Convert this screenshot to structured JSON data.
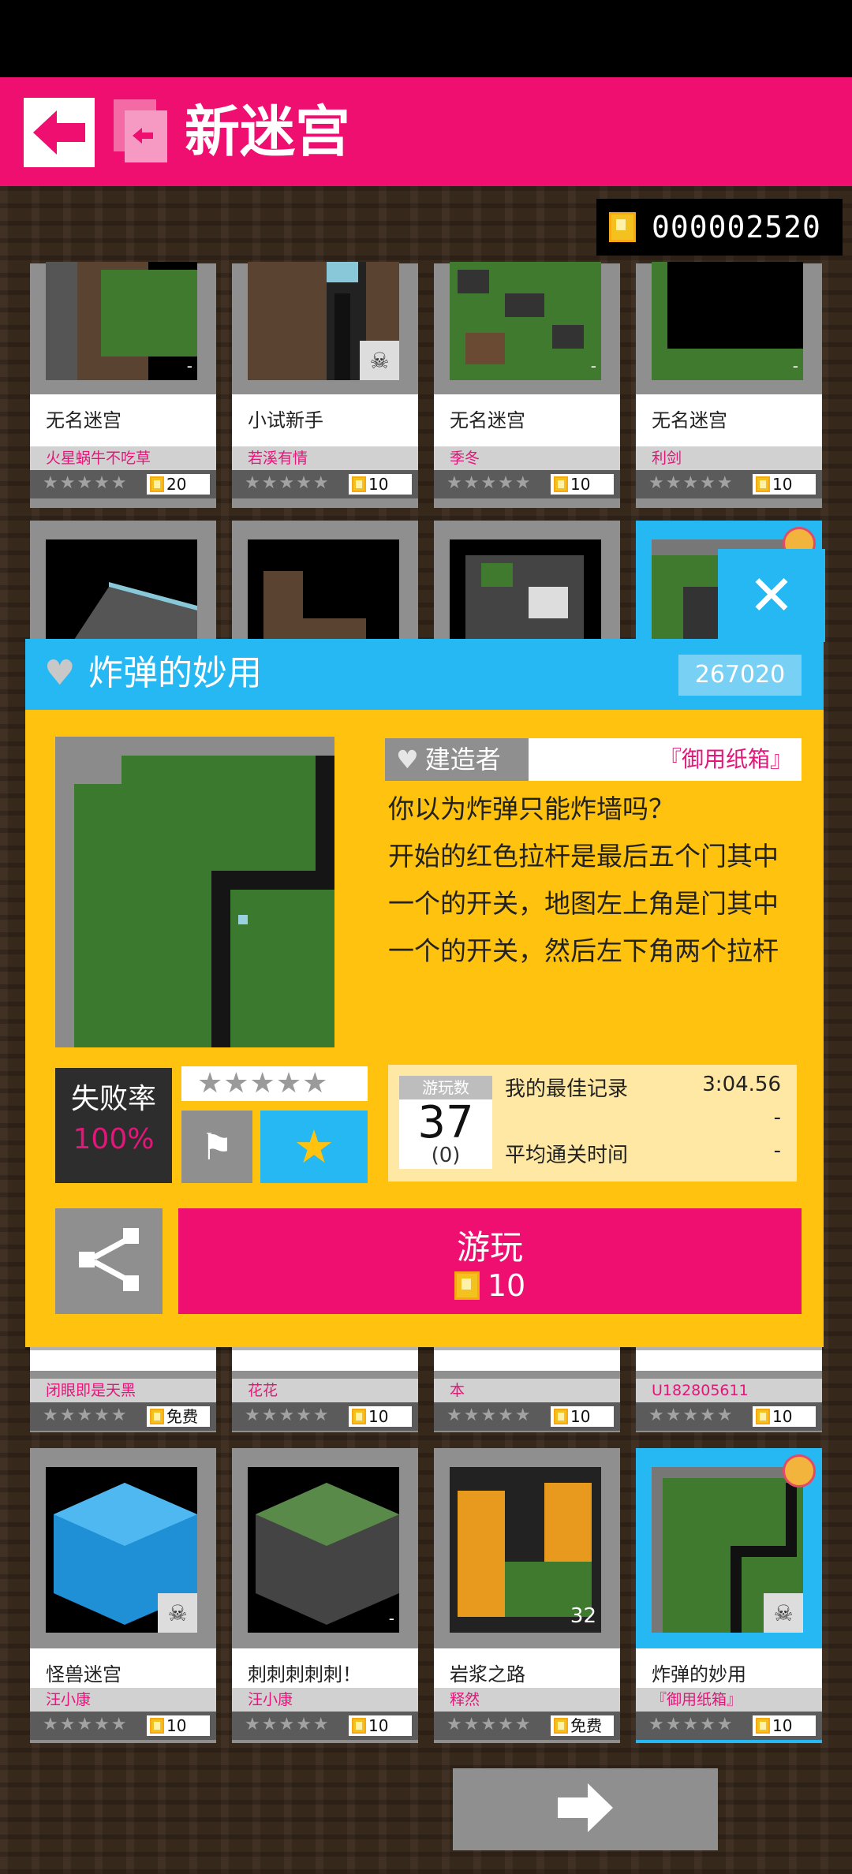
{
  "header": {
    "title": "新迷宫"
  },
  "coins": {
    "value": "000002520"
  },
  "cards_row1": [
    {
      "name": "无名迷宫",
      "author": "火星蜗牛不吃草",
      "price": "20",
      "corner": "-"
    },
    {
      "name": "小试新手",
      "author": "若溪有情",
      "price": "10",
      "corner": ""
    },
    {
      "name": "无名迷宫",
      "author": "季冬",
      "price": "10",
      "corner": "-"
    },
    {
      "name": "无名迷宫",
      "author": "利剑",
      "price": "10",
      "corner": "-"
    }
  ],
  "cards_row3": [
    {
      "author": "闭眼即是天黑",
      "price": "免费"
    },
    {
      "author": "花花",
      "price": "10"
    },
    {
      "author": "本",
      "price": "10"
    },
    {
      "author": "U182805611",
      "price": "10"
    }
  ],
  "cards_row4": [
    {
      "name": "怪兽迷宫",
      "author": "汪小康",
      "price": "10",
      "corner": ""
    },
    {
      "name": "刺刺刺刺刺！",
      "author": "汪小康",
      "price": "10",
      "corner": "-"
    },
    {
      "name": "岩浆之路",
      "author": "释然",
      "price": "免费",
      "corner": "32"
    },
    {
      "name": "炸弹的妙用",
      "author": "『御用纸箱』",
      "price": "10",
      "corner": ""
    }
  ],
  "stars_text": "★★★★★",
  "detail": {
    "title": "炸弹的妙用",
    "id": "267020",
    "builder_label": "建造者",
    "builder_name": "『御用纸箱』",
    "description": "你以为炸弹只能炸墙吗？\n开始的红色拉杆是最后五个门其中一个的开关，地图左上角是门其中一个的开关，然后左下角两个拉杆是中的两个开关，还有",
    "fail_label": "失败率",
    "fail_value": "100%",
    "rating_stars": "★★★★★",
    "plays_label": "游玩数",
    "plays_value": "37",
    "plays_sub": "(0)",
    "best_label": "我的最佳记录",
    "best_value": "3:04.56",
    "row2_value": "-",
    "avg_label": "平均通关时间",
    "avg_value": "-",
    "play_label": "游玩",
    "play_price": "10"
  },
  "colors": {
    "brand": "#ee0f70",
    "accent": "#25b8f2",
    "panel": "#ffc20e"
  }
}
